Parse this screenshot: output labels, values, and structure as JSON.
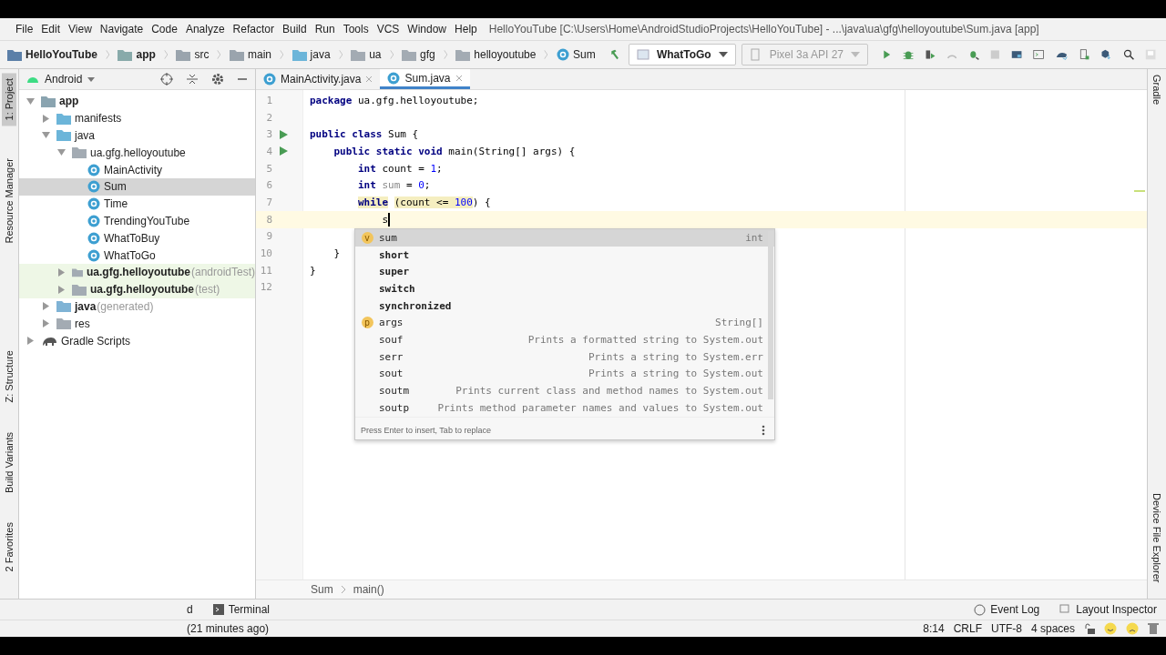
{
  "window": {
    "title": "HelloYouTube [C:\\Users\\Home\\AndroidStudioProjects\\HelloYouTube] - ...\\java\\ua\\gfg\\helloyoutube\\Sum.java [app]"
  },
  "menu": [
    "File",
    "Edit",
    "View",
    "Navigate",
    "Code",
    "Analyze",
    "Refactor",
    "Build",
    "Run",
    "Tools",
    "VCS",
    "Window",
    "Help"
  ],
  "breadcrumbs": [
    {
      "label": "HelloYouTube",
      "kind": "project"
    },
    {
      "label": "app",
      "kind": "module"
    },
    {
      "label": "src",
      "kind": "folder"
    },
    {
      "label": "main",
      "kind": "folder"
    },
    {
      "label": "java",
      "kind": "source"
    },
    {
      "label": "ua",
      "kind": "package"
    },
    {
      "label": "gfg",
      "kind": "package"
    },
    {
      "label": "helloyoutube",
      "kind": "package"
    },
    {
      "label": "Sum",
      "kind": "class"
    }
  ],
  "toolbar": {
    "run_config": "WhatToGo",
    "device": "Pixel 3a API 27"
  },
  "left_strip": [
    {
      "label": "1: Project",
      "selected": true
    },
    {
      "label": "Resource Manager",
      "selected": false
    },
    {
      "label": "Z: Structure",
      "selected": false
    },
    {
      "label": "Build Variants",
      "selected": false
    },
    {
      "label": "2 Favorites",
      "selected": false
    }
  ],
  "right_strip": [
    "Gradle",
    "Device File Explorer"
  ],
  "project_panel": {
    "view": "Android",
    "tree": [
      {
        "label": "app",
        "kind": "module",
        "bold": true,
        "expanded": true,
        "selected": false,
        "highlighted": false,
        "children": [
          {
            "label": "manifests",
            "kind": "folder",
            "bold": false,
            "expanded": false,
            "selected": false,
            "highlighted": false
          },
          {
            "label": "java",
            "kind": "folder",
            "bold": false,
            "expanded": true,
            "selected": false,
            "highlighted": false,
            "children": [
              {
                "label": "ua.gfg.helloyoutube",
                "kind": "package",
                "bold": false,
                "expanded": true,
                "selected": false,
                "highlighted": false,
                "children": [
                  {
                    "label": "MainActivity",
                    "kind": "class",
                    "bold": false,
                    "selected": false,
                    "highlighted": false
                  },
                  {
                    "label": "Sum",
                    "kind": "class",
                    "bold": false,
                    "selected": true,
                    "highlighted": false
                  },
                  {
                    "label": "Time",
                    "kind": "class",
                    "bold": false,
                    "selected": false,
                    "highlighted": false
                  },
                  {
                    "label": "TrendingYouTube",
                    "kind": "class",
                    "bold": false,
                    "selected": false,
                    "highlighted": false
                  },
                  {
                    "label": "WhatToBuy",
                    "kind": "class",
                    "bold": false,
                    "selected": false,
                    "highlighted": false
                  },
                  {
                    "label": "WhatToGo",
                    "kind": "class",
                    "bold": false,
                    "selected": false,
                    "highlighted": false
                  }
                ]
              },
              {
                "label": "ua.gfg.helloyoutube",
                "suffix": "(androidTest)",
                "kind": "package",
                "bold": true,
                "expanded": false,
                "selected": false,
                "highlighted": true
              },
              {
                "label": "ua.gfg.helloyoutube",
                "suffix": "(test)",
                "kind": "package",
                "bold": true,
                "expanded": false,
                "selected": false,
                "highlighted": true
              }
            ]
          },
          {
            "label": "java",
            "suffix": "(generated)",
            "kind": "generated",
            "bold": true,
            "expanded": false,
            "selected": false,
            "highlighted": false
          },
          {
            "label": "res",
            "kind": "res",
            "bold": false,
            "expanded": false,
            "selected": false,
            "highlighted": false
          }
        ]
      },
      {
        "label": "Gradle Scripts",
        "kind": "gradle",
        "bold": false,
        "expanded": false,
        "selected": false,
        "highlighted": false
      }
    ]
  },
  "editor_tabs": [
    {
      "label": "MainActivity.java",
      "selected": false
    },
    {
      "label": "Sum.java",
      "selected": true
    }
  ],
  "code_lines": [
    {
      "number": "1",
      "run": false,
      "current": false,
      "tokens": [
        {
          "text": "package",
          "kind": "kw"
        },
        {
          "text": " ua.gfg.helloyoutube;",
          "kind": "plain"
        }
      ]
    },
    {
      "number": "2",
      "run": false,
      "current": false
    },
    {
      "number": "3",
      "run": true,
      "current": false,
      "tokens": [
        {
          "text": "public class",
          "kind": "kw"
        },
        {
          "text": " Sum {",
          "kind": "plain"
        }
      ]
    },
    {
      "number": "4",
      "run": true,
      "current": false,
      "tokens": [
        {
          "text": "    public static void",
          "kind": "kw"
        },
        {
          "text": " main(String[] args) {",
          "kind": "plain"
        }
      ]
    },
    {
      "number": "5",
      "run": false,
      "current": false,
      "tokens": [
        {
          "text": "        int",
          "kind": "kw"
        },
        {
          "text": " count = ",
          "kind": "plain"
        },
        {
          "text": "1",
          "kind": "num"
        },
        {
          "text": ";",
          "kind": "plain"
        }
      ]
    },
    {
      "number": "6",
      "run": false,
      "current": false,
      "tokens": [
        {
          "text": "        int",
          "kind": "kw"
        },
        {
          "text": " sum",
          "kind": "unused"
        },
        {
          "text": " = ",
          "kind": "plain"
        },
        {
          "text": "0",
          "kind": "num"
        },
        {
          "text": ";",
          "kind": "plain"
        }
      ]
    },
    {
      "number": "7",
      "run": false,
      "current": false,
      "tokens": [
        {
          "text": "        while",
          "kind": "kw_mark"
        },
        {
          "text": " (count <= ",
          "kind": "mark"
        },
        {
          "text": "100",
          "kind": "num_mark"
        },
        {
          "text": ") {",
          "kind": "plain"
        }
      ]
    },
    {
      "number": "8",
      "run": false,
      "current": true,
      "tokens": [
        {
          "text": "            s",
          "kind": "plain"
        }
      ]
    },
    {
      "number": "9",
      "run": false,
      "current": false
    },
    {
      "number": "10",
      "run": false,
      "current": false,
      "tokens": [
        {
          "text": "    }",
          "kind": "plain"
        }
      ]
    },
    {
      "number": "11",
      "run": false,
      "current": false,
      "tokens": [
        {
          "text": "}",
          "kind": "plain"
        }
      ]
    },
    {
      "number": "12",
      "run": false,
      "current": false
    }
  ],
  "completion": {
    "items": [
      {
        "name": "sum",
        "kind": "variable",
        "badge": "v",
        "type": "int",
        "selected": true
      },
      {
        "name": "short",
        "kind": "keyword",
        "selected": false
      },
      {
        "name": "super",
        "kind": "keyword",
        "selected": false
      },
      {
        "name": "switch",
        "kind": "keyword",
        "selected": false
      },
      {
        "name": "synchronized",
        "kind": "keyword",
        "selected": false
      },
      {
        "name": "args",
        "kind": "parameter",
        "badge": "p",
        "type": "String[]",
        "selected": false
      },
      {
        "name": "souf",
        "kind": "template",
        "type": "Prints a formatted string to System.out",
        "selected": false
      },
      {
        "name": "serr",
        "kind": "template",
        "type": "Prints a string to System.err",
        "selected": false
      },
      {
        "name": "sout",
        "kind": "template",
        "type": "Prints a string to System.out",
        "selected": false
      },
      {
        "name": "soutm",
        "kind": "template",
        "type": "Prints current class and method names to System.out",
        "selected": false
      },
      {
        "name": "soutp",
        "kind": "template",
        "type": "Prints method parameter names and values to System.out",
        "selected": false
      }
    ],
    "footer": "Press Enter to insert, Tab to replace"
  },
  "editor_breadcrumbs": [
    "Sum",
    "main()"
  ],
  "tool_tabs_left": [
    "d",
    "Terminal"
  ],
  "tool_tabs_right": [
    "Event Log",
    "Layout Inspector"
  ],
  "status_bar": {
    "message": "(21 minutes ago)",
    "position": "8:14",
    "line_separator": "CRLF",
    "encoding": "UTF-8",
    "indent": "4 spaces"
  }
}
